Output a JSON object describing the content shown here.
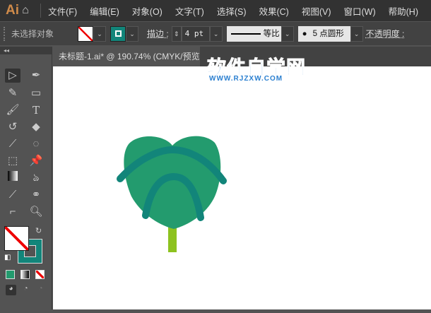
{
  "app": {
    "logo": "Ai"
  },
  "menu": [
    "文件(F)",
    "编辑(E)",
    "对象(O)",
    "文字(T)",
    "选择(S)",
    "效果(C)",
    "视图(V)",
    "窗口(W)",
    "帮助(H)"
  ],
  "control": {
    "selection": "未选择对象",
    "stroke_label": "描边 :",
    "stroke_value": "4 pt",
    "profile": "等比",
    "brush": "5 点圆形",
    "opacity_label": "不透明度 :"
  },
  "document": {
    "tab_title": "未标题-1.ai* @ 190.74% (CMYK/预览)"
  },
  "watermark": {
    "title": "软件自学网",
    "url": "WWW.RJZXW.COM"
  },
  "colors": {
    "fill": "#239b6e",
    "stroke": "#12857a",
    "stem": "#8dc21f",
    "accent": "#d08b4a"
  }
}
